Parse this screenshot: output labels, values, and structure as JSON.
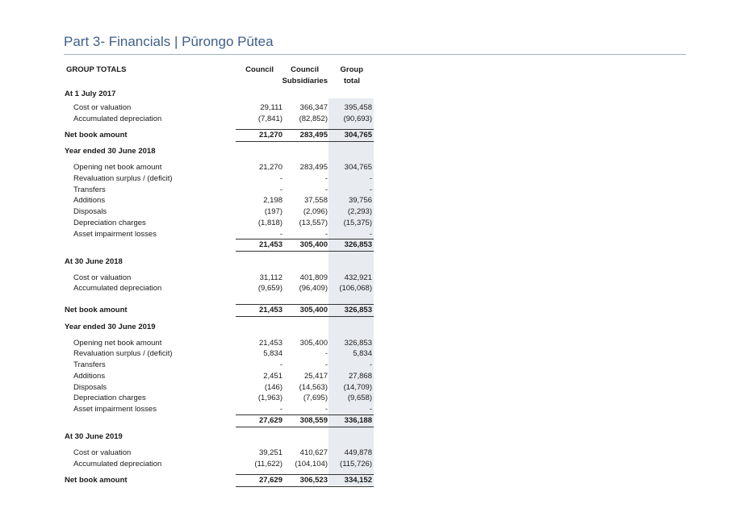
{
  "page_title": "Part 3- Financials | Pūrongo Pūtea",
  "table": {
    "header": {
      "label": "GROUP TOTALS",
      "col1": "Council",
      "col2_line1": "Council",
      "col2_line2": "Subsidiaries",
      "col3_line1": "Group",
      "col3_line2": "total"
    },
    "rows": [
      {
        "label": "At 1 July 2017",
        "type": "section"
      },
      {
        "label": "Cost or valuation",
        "type": "item",
        "values": [
          "29,111",
          "366,347",
          "395,458"
        ]
      },
      {
        "label": "Accumulated depreciation",
        "type": "item",
        "values": [
          "(7,841)",
          "(82,852)",
          "(90,693)"
        ]
      },
      {
        "label": "Net book amount",
        "type": "total",
        "values": [
          "21,270",
          "283,495",
          "304,765"
        ]
      },
      {
        "label": "Year ended 30 June 2018",
        "type": "section"
      },
      {
        "label": "Opening net book amount",
        "type": "item",
        "values": [
          "21,270",
          "283,495",
          "304,765"
        ]
      },
      {
        "label": "Revaluation surplus / (deficit)",
        "type": "item",
        "values": [
          "-",
          "-",
          "-"
        ]
      },
      {
        "label": "Transfers",
        "type": "item",
        "values": [
          "-",
          "-",
          "-"
        ]
      },
      {
        "label": "Additions",
        "type": "item",
        "values": [
          "2,198",
          "37,558",
          "39,756"
        ]
      },
      {
        "label": "Disposals",
        "type": "item",
        "values": [
          "(197)",
          "(2,096)",
          "(2,293)"
        ]
      },
      {
        "label": "Depreciation charges",
        "type": "item",
        "values": [
          "(1,818)",
          "(13,557)",
          "(15,375)"
        ]
      },
      {
        "label": "Asset impairment losses",
        "type": "item",
        "values": [
          "-",
          "-",
          "-"
        ]
      },
      {
        "label": "",
        "type": "subtotal",
        "values": [
          "21,453",
          "305,400",
          "326,853"
        ]
      },
      {
        "label": "At 30 June 2018",
        "type": "section"
      },
      {
        "label": "Cost or valuation",
        "type": "item",
        "values": [
          "31,112",
          "401,809",
          "432,921"
        ]
      },
      {
        "label": "Accumulated depreciation",
        "type": "item",
        "values": [
          "(9,659)",
          "(96,409)",
          "(106,068)"
        ]
      },
      {
        "label": "Net book amount",
        "type": "total",
        "values": [
          "21,453",
          "305,400",
          "326,853"
        ]
      },
      {
        "label": "Year ended 30 June 2019",
        "type": "section"
      },
      {
        "label": "Opening net book amount",
        "type": "item",
        "values": [
          "21,453",
          "305,400",
          "326,853"
        ]
      },
      {
        "label": "Revaluation surplus / (deficit)",
        "type": "item",
        "values": [
          "5,834",
          "-",
          "5,834"
        ]
      },
      {
        "label": "Transfers",
        "type": "item",
        "values": [
          "-",
          "-",
          "-"
        ]
      },
      {
        "label": "Additions",
        "type": "item",
        "values": [
          "2,451",
          "25,417",
          "27,868"
        ]
      },
      {
        "label": "Disposals",
        "type": "item",
        "values": [
          "(146)",
          "(14,563)",
          "(14,709)"
        ]
      },
      {
        "label": "Depreciation charges",
        "type": "item",
        "values": [
          "(1,963)",
          "(7,695)",
          "(9,658)"
        ]
      },
      {
        "label": "Asset impairment losses",
        "type": "item",
        "values": [
          "-",
          "-",
          "-"
        ]
      },
      {
        "label": "",
        "type": "subtotal",
        "values": [
          "27,629",
          "308,559",
          "336,188"
        ]
      },
      {
        "label": "At 30 June 2019",
        "type": "section"
      },
      {
        "label": "Cost or valuation",
        "type": "item",
        "values": [
          "39,251",
          "410,627",
          "449,878"
        ]
      },
      {
        "label": "Accumulated depreciation",
        "type": "item",
        "values": [
          "(11,622)",
          "(104,104)",
          "(115,726)"
        ]
      },
      {
        "label": "Net book amount",
        "type": "total",
        "values": [
          "27,629",
          "306,523",
          "334,152"
        ]
      }
    ]
  }
}
